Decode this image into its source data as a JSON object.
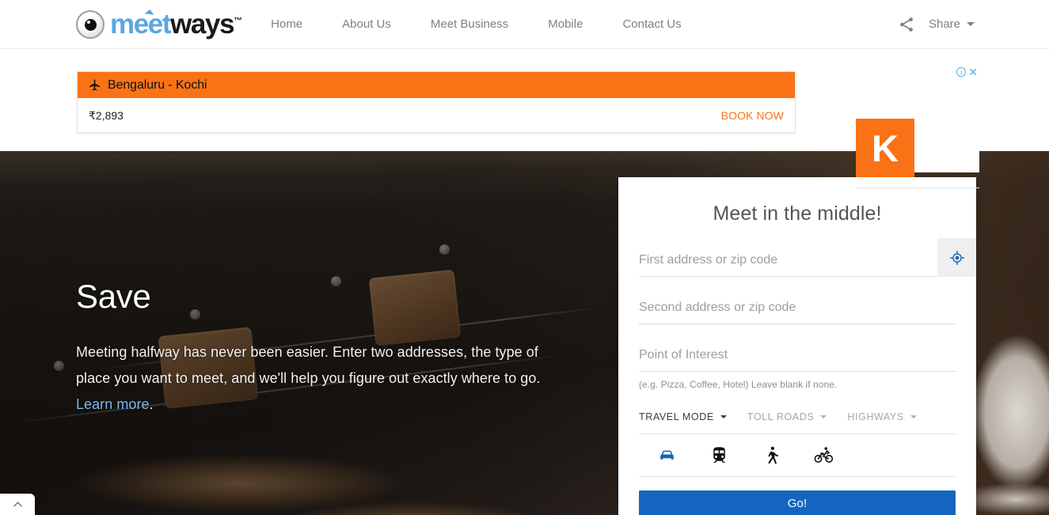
{
  "header": {
    "logo": {
      "icon": "eye-icon",
      "text_primary": "meet",
      "text_secondary": "ways",
      "trademark": "™"
    },
    "nav_items": [
      {
        "label": "Home"
      },
      {
        "label": "About Us"
      },
      {
        "label": "Meet Business"
      },
      {
        "label": "Mobile"
      },
      {
        "label": "Contact Us"
      }
    ],
    "share": {
      "icon": "share-icon",
      "label": "Share",
      "caret_icon": "caret-down-icon"
    }
  },
  "advertisement": {
    "flight_banner": {
      "icon": "airplane-icon",
      "route": "Bengaluru - Kochi",
      "price": "₹2,893",
      "cta_label": "BOOK NOW",
      "accent_color": "#f97316"
    },
    "square_ad": {
      "letter": "K",
      "background_color": "#f97316"
    },
    "adchoices": {
      "info_icon": "info-icon",
      "info_glyph": "i",
      "close_icon": "close-icon",
      "close_glyph": "✕"
    }
  },
  "hero": {
    "title": "Save",
    "body_before_link": "Meeting halfway has never been easier. Enter two addresses, the type of place you want to meet, and we'll help you figure out exactly where to go. ",
    "link_label": "Learn more",
    "body_after_link": ".",
    "link_color": "#7cb9ec"
  },
  "form_card": {
    "title": "Meet in the middle!",
    "first_address": {
      "value": "",
      "placeholder": "First address or zip code"
    },
    "geolocate_button": {
      "icon": "crosshair-location-icon"
    },
    "second_address": {
      "value": "",
      "placeholder": "Second address or zip code"
    },
    "point_of_interest": {
      "value": "",
      "placeholder": "Point of Interest"
    },
    "poi_hint": "(e.g. Pizza, Coffee, Hotel) Leave blank if none.",
    "options": [
      {
        "label": "TRAVEL MODE",
        "active": true
      },
      {
        "label": "TOLL ROADS",
        "active": false
      },
      {
        "label": "HIGHWAYS",
        "active": false
      }
    ],
    "travel_modes": [
      {
        "name": "driving",
        "icon": "car-icon",
        "selected": true
      },
      {
        "name": "transit",
        "icon": "train-icon",
        "selected": false
      },
      {
        "name": "walking",
        "icon": "walk-icon",
        "selected": false
      },
      {
        "name": "bicycling",
        "icon": "bicycle-icon",
        "selected": false
      }
    ],
    "submit_label": "Go!",
    "submit_color": "#1565c0",
    "selected_mode_color": "#1565c0"
  },
  "scroll_top": {
    "icon": "chevron-up-icon"
  }
}
